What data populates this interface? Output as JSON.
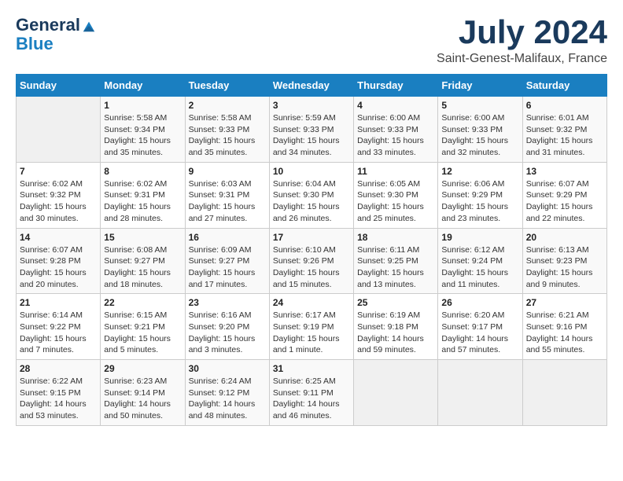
{
  "logo": {
    "general": "General",
    "blue": "Blue"
  },
  "title": "July 2024",
  "subtitle": "Saint-Genest-Malifaux, France",
  "days_of_week": [
    "Sunday",
    "Monday",
    "Tuesday",
    "Wednesday",
    "Thursday",
    "Friday",
    "Saturday"
  ],
  "weeks": [
    [
      {
        "day": "",
        "info": ""
      },
      {
        "day": "1",
        "info": "Sunrise: 5:58 AM\nSunset: 9:34 PM\nDaylight: 15 hours\nand 35 minutes."
      },
      {
        "day": "2",
        "info": "Sunrise: 5:58 AM\nSunset: 9:33 PM\nDaylight: 15 hours\nand 35 minutes."
      },
      {
        "day": "3",
        "info": "Sunrise: 5:59 AM\nSunset: 9:33 PM\nDaylight: 15 hours\nand 34 minutes."
      },
      {
        "day": "4",
        "info": "Sunrise: 6:00 AM\nSunset: 9:33 PM\nDaylight: 15 hours\nand 33 minutes."
      },
      {
        "day": "5",
        "info": "Sunrise: 6:00 AM\nSunset: 9:33 PM\nDaylight: 15 hours\nand 32 minutes."
      },
      {
        "day": "6",
        "info": "Sunrise: 6:01 AM\nSunset: 9:32 PM\nDaylight: 15 hours\nand 31 minutes."
      }
    ],
    [
      {
        "day": "7",
        "info": "Sunrise: 6:02 AM\nSunset: 9:32 PM\nDaylight: 15 hours\nand 30 minutes."
      },
      {
        "day": "8",
        "info": "Sunrise: 6:02 AM\nSunset: 9:31 PM\nDaylight: 15 hours\nand 28 minutes."
      },
      {
        "day": "9",
        "info": "Sunrise: 6:03 AM\nSunset: 9:31 PM\nDaylight: 15 hours\nand 27 minutes."
      },
      {
        "day": "10",
        "info": "Sunrise: 6:04 AM\nSunset: 9:30 PM\nDaylight: 15 hours\nand 26 minutes."
      },
      {
        "day": "11",
        "info": "Sunrise: 6:05 AM\nSunset: 9:30 PM\nDaylight: 15 hours\nand 25 minutes."
      },
      {
        "day": "12",
        "info": "Sunrise: 6:06 AM\nSunset: 9:29 PM\nDaylight: 15 hours\nand 23 minutes."
      },
      {
        "day": "13",
        "info": "Sunrise: 6:07 AM\nSunset: 9:29 PM\nDaylight: 15 hours\nand 22 minutes."
      }
    ],
    [
      {
        "day": "14",
        "info": "Sunrise: 6:07 AM\nSunset: 9:28 PM\nDaylight: 15 hours\nand 20 minutes."
      },
      {
        "day": "15",
        "info": "Sunrise: 6:08 AM\nSunset: 9:27 PM\nDaylight: 15 hours\nand 18 minutes."
      },
      {
        "day": "16",
        "info": "Sunrise: 6:09 AM\nSunset: 9:27 PM\nDaylight: 15 hours\nand 17 minutes."
      },
      {
        "day": "17",
        "info": "Sunrise: 6:10 AM\nSunset: 9:26 PM\nDaylight: 15 hours\nand 15 minutes."
      },
      {
        "day": "18",
        "info": "Sunrise: 6:11 AM\nSunset: 9:25 PM\nDaylight: 15 hours\nand 13 minutes."
      },
      {
        "day": "19",
        "info": "Sunrise: 6:12 AM\nSunset: 9:24 PM\nDaylight: 15 hours\nand 11 minutes."
      },
      {
        "day": "20",
        "info": "Sunrise: 6:13 AM\nSunset: 9:23 PM\nDaylight: 15 hours\nand 9 minutes."
      }
    ],
    [
      {
        "day": "21",
        "info": "Sunrise: 6:14 AM\nSunset: 9:22 PM\nDaylight: 15 hours\nand 7 minutes."
      },
      {
        "day": "22",
        "info": "Sunrise: 6:15 AM\nSunset: 9:21 PM\nDaylight: 15 hours\nand 5 minutes."
      },
      {
        "day": "23",
        "info": "Sunrise: 6:16 AM\nSunset: 9:20 PM\nDaylight: 15 hours\nand 3 minutes."
      },
      {
        "day": "24",
        "info": "Sunrise: 6:17 AM\nSunset: 9:19 PM\nDaylight: 15 hours\nand 1 minute."
      },
      {
        "day": "25",
        "info": "Sunrise: 6:19 AM\nSunset: 9:18 PM\nDaylight: 14 hours\nand 59 minutes."
      },
      {
        "day": "26",
        "info": "Sunrise: 6:20 AM\nSunset: 9:17 PM\nDaylight: 14 hours\nand 57 minutes."
      },
      {
        "day": "27",
        "info": "Sunrise: 6:21 AM\nSunset: 9:16 PM\nDaylight: 14 hours\nand 55 minutes."
      }
    ],
    [
      {
        "day": "28",
        "info": "Sunrise: 6:22 AM\nSunset: 9:15 PM\nDaylight: 14 hours\nand 53 minutes."
      },
      {
        "day": "29",
        "info": "Sunrise: 6:23 AM\nSunset: 9:14 PM\nDaylight: 14 hours\nand 50 minutes."
      },
      {
        "day": "30",
        "info": "Sunrise: 6:24 AM\nSunset: 9:12 PM\nDaylight: 14 hours\nand 48 minutes."
      },
      {
        "day": "31",
        "info": "Sunrise: 6:25 AM\nSunset: 9:11 PM\nDaylight: 14 hours\nand 46 minutes."
      },
      {
        "day": "",
        "info": ""
      },
      {
        "day": "",
        "info": ""
      },
      {
        "day": "",
        "info": ""
      }
    ]
  ]
}
